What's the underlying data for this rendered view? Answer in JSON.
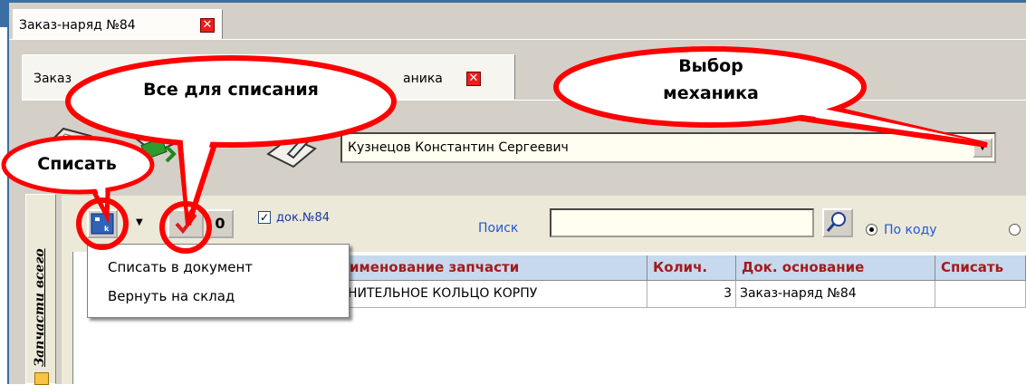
{
  "outer_tab": {
    "label": "Заказ-наряд №84",
    "close_icon": "close-icon"
  },
  "inner_tabs": {
    "left_label": "Заказ",
    "right_label": "аника"
  },
  "mechanic": {
    "value": "Кузнецов Константин Сергеевич"
  },
  "side_tab": {
    "label": "Запчасти всего"
  },
  "parts_toolbar": {
    "zero_button": "0",
    "doc_checkbox_label": "док.№84",
    "doc_checkbox_checked": true,
    "search_label": "Поиск",
    "search_value": "",
    "radio_by_code": "По коду",
    "radio_by_code_checked": true
  },
  "grid": {
    "columns": [
      "именование запчасти",
      "Колич.",
      "Док. основание",
      "Списать"
    ],
    "rows": [
      {
        "name": "НИТЕЛЬНОЕ КОЛЬЦО КОРПУ",
        "qty": "3",
        "doc": "Заказ-наряд №84",
        "writeoff": ""
      }
    ]
  },
  "popup_menu": {
    "items": [
      "Списать в документ",
      "Вернуть на склад"
    ]
  },
  "callouts": {
    "write_off": "Списать",
    "all_for_write_off": "Все для списания",
    "choose_mechanic_line1": "Выбор",
    "choose_mechanic_line2": "механика"
  },
  "colors": {
    "accent": "#3a6ea5",
    "callout_red": "#ff0000",
    "header_text": "#a31b1b"
  }
}
